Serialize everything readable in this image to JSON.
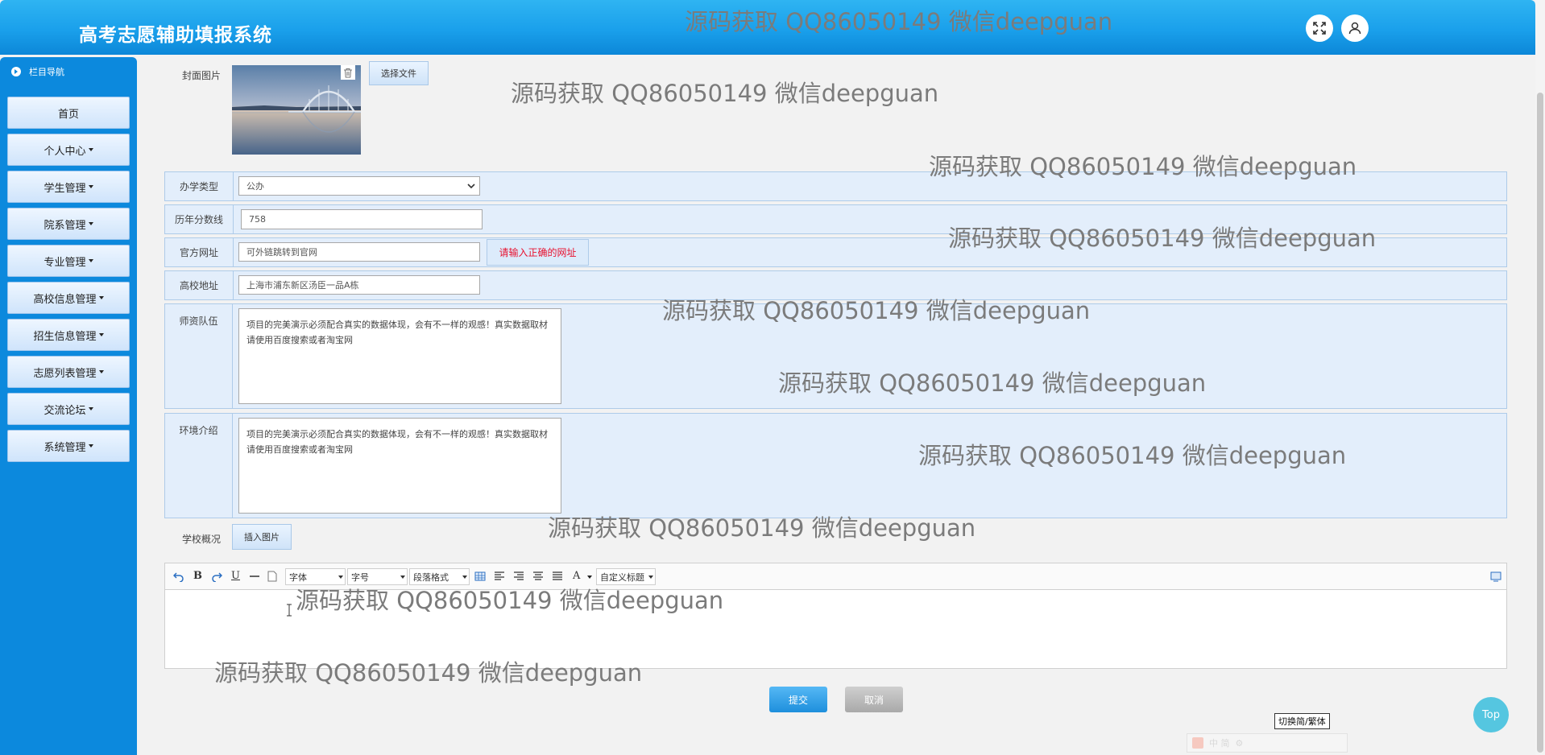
{
  "header": {
    "title": "高考志愿辅助填报系统"
  },
  "sidebar": {
    "nav_title": "栏目导航",
    "items": [
      {
        "label": "首页"
      },
      {
        "label": "个人中心"
      },
      {
        "label": "学生管理"
      },
      {
        "label": "院系管理"
      },
      {
        "label": "专业管理"
      },
      {
        "label": "高校信息管理"
      },
      {
        "label": "招生信息管理"
      },
      {
        "label": "志愿列表管理"
      },
      {
        "label": "交流论坛"
      },
      {
        "label": "系统管理"
      }
    ]
  },
  "form": {
    "cover": {
      "label": "封面图片",
      "choose_file": "选择文件"
    },
    "school_type": {
      "label": "办学类型",
      "value": "公办"
    },
    "score_line": {
      "label": "历年分数线",
      "value": "758"
    },
    "website": {
      "label": "官方网址",
      "value": "可外链跳转到官网",
      "error": "请输入正确的网址"
    },
    "address": {
      "label": "高校地址",
      "value": "上海市浦东新区汤臣一品A栋"
    },
    "faculty": {
      "label": "师资队伍",
      "value": "项目的完美演示必须配合真实的数据体现，会有不一样的观感！真实数据取材请使用百度搜索或者淘宝网"
    },
    "environment": {
      "label": "环境介绍",
      "value": "项目的完美演示必须配合真实的数据体现，会有不一样的观感！真实数据取材请使用百度搜索或者淘宝网"
    },
    "overview": {
      "label": "学校概况",
      "insert_image": "插入图片"
    }
  },
  "editor": {
    "toolbar": {
      "font": "字体",
      "size": "字号",
      "paragraph": "段落格式",
      "custom_title": "自定义标题",
      "bold": "B",
      "underline": "U",
      "font_color": "A"
    }
  },
  "actions": {
    "submit": "提交",
    "cancel": "取消"
  },
  "misc": {
    "switch_label": "切换简/繁体",
    "top_label": "Top",
    "ime_chars": "中 简"
  },
  "watermark": {
    "text": "源码获取 QQ86050149 微信deepguan"
  }
}
